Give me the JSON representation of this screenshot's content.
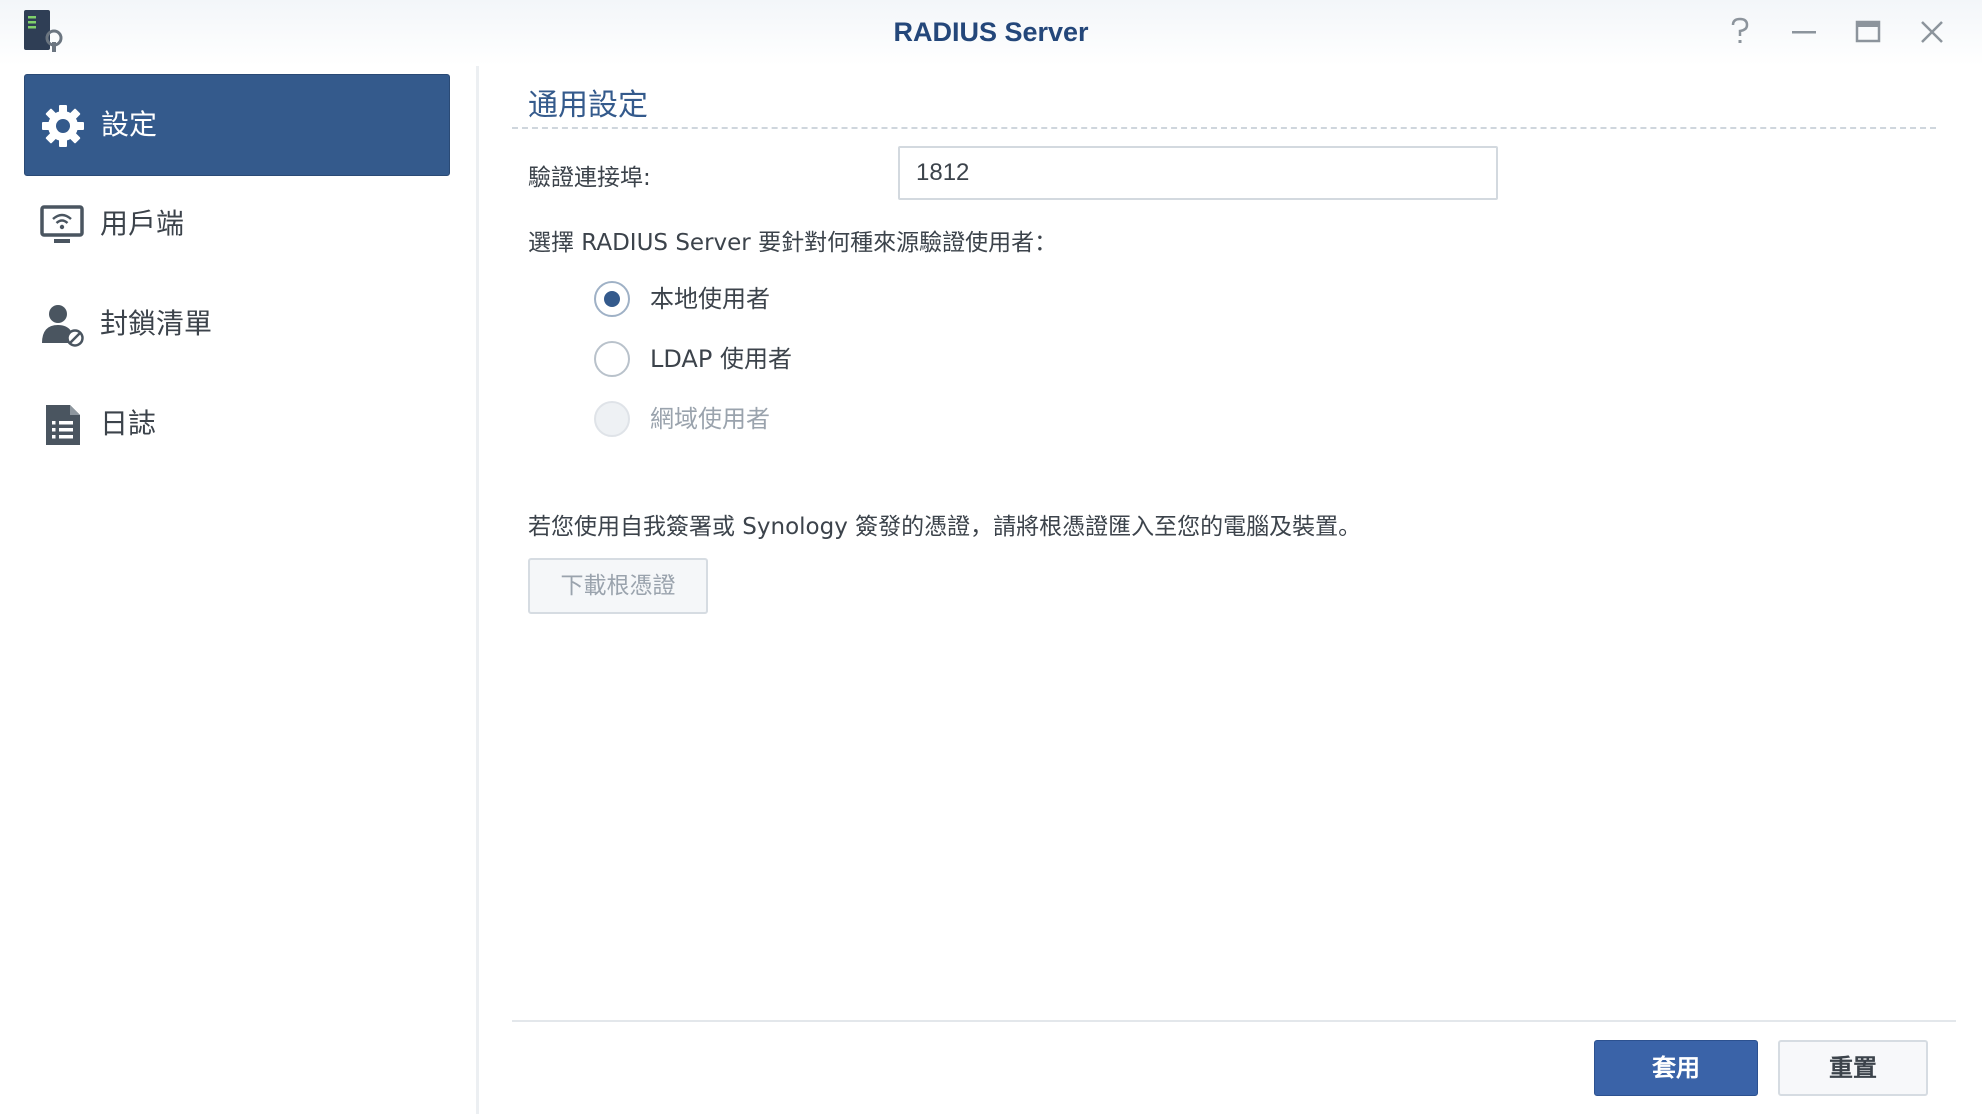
{
  "window": {
    "title": "RADIUS Server",
    "app_icon": "radius-server-app-icon",
    "controls": [
      "help-icon",
      "minimize-icon",
      "maximize-icon",
      "close-icon"
    ]
  },
  "sidebar": {
    "items": [
      {
        "label": "設定",
        "icon": "gear-icon",
        "active": true
      },
      {
        "label": "用戶端",
        "icon": "wifi-monitor-icon",
        "active": false
      },
      {
        "label": "封鎖清單",
        "icon": "blocked-user-icon",
        "active": false
      },
      {
        "label": "日誌",
        "icon": "log-document-icon",
        "active": false
      }
    ]
  },
  "main": {
    "section_title": "通用設定",
    "port": {
      "label": "驗證連接埠:",
      "value": "1812"
    },
    "source_question": "選擇 RADIUS Server 要針對何種來源驗證使用者：",
    "sources": [
      {
        "label": "本地使用者",
        "checked": true,
        "disabled": false
      },
      {
        "label": "LDAP 使用者",
        "checked": false,
        "disabled": false
      },
      {
        "label": "網域使用者",
        "checked": false,
        "disabled": true
      }
    ],
    "cert_note": "若您使用自我簽署或 Synology 簽發的憑證，請將根憑證匯入至您的電腦及裝置。",
    "download_button": "下載根憑證"
  },
  "footer": {
    "apply_label": "套用",
    "reset_label": "重置"
  },
  "colors": {
    "accent": "#345a8c",
    "title": "#24477a",
    "apply": "#3a63a8"
  }
}
